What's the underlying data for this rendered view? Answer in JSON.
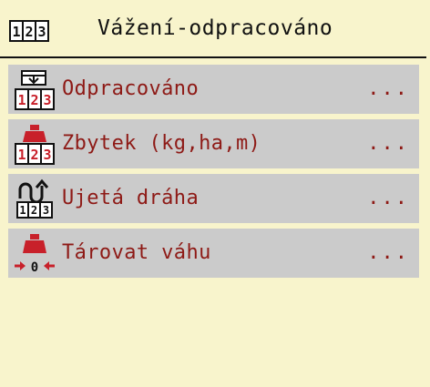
{
  "header": {
    "icon": "counter-123-icon",
    "title": "Vážení-odpracováno"
  },
  "menu": {
    "items": [
      {
        "label": "Odpracováno",
        "more": "...",
        "icon": "counter-funnel-icon"
      },
      {
        "label": "Zbytek (kg,ha,m)",
        "more": "...",
        "icon": "weight-counter-icon"
      },
      {
        "label": "Ujetá dráha",
        "more": "...",
        "icon": "distance-route-icon"
      },
      {
        "label": "Tárovat váhu",
        "more": "...",
        "icon": "tare-scale-icon"
      }
    ]
  },
  "colors": {
    "background": "#f8f4cc",
    "item_background": "#cbcbcb",
    "label": "#8e1a16",
    "accent_red": "#c8202a"
  }
}
